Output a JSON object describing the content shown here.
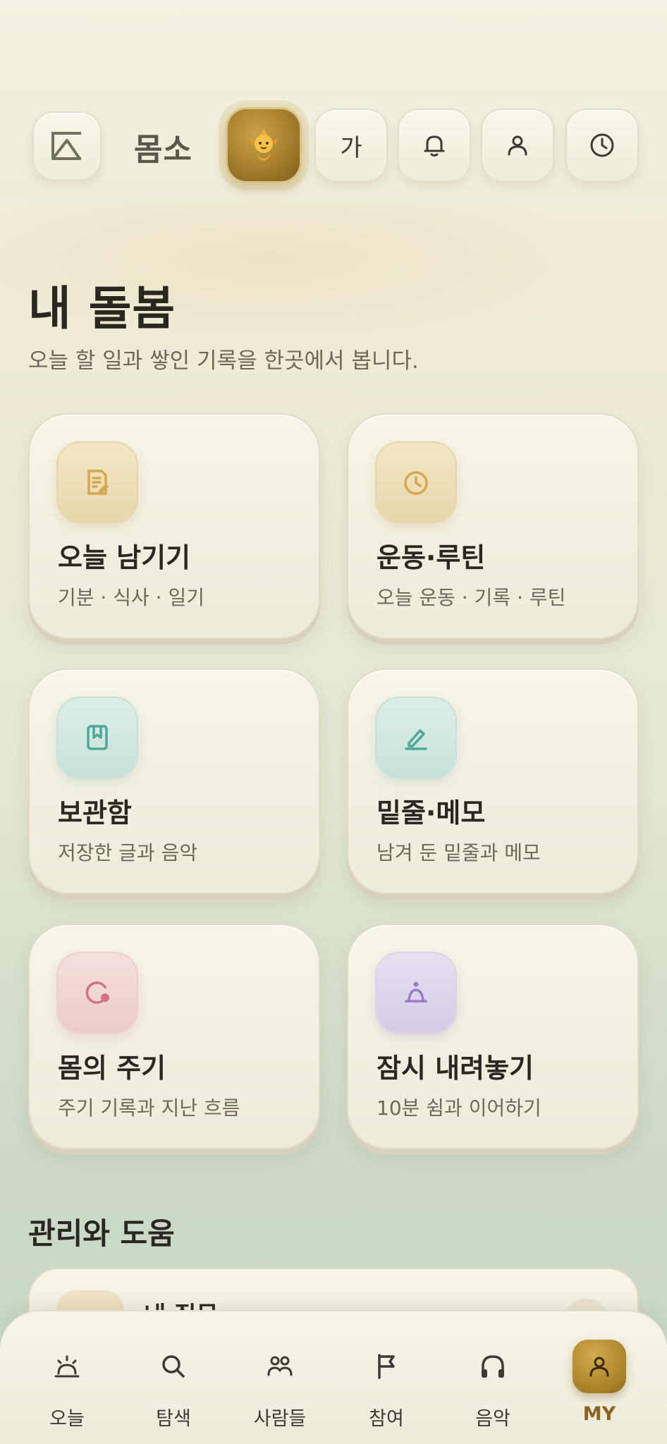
{
  "header": {
    "brand": "몸소",
    "text_size_label": "가",
    "icons": [
      "mountain-logo-icon",
      "mascot-icon",
      "bell-icon",
      "person-icon",
      "clock-icon"
    ]
  },
  "main": {
    "title": "내 돌봄",
    "subtitle": "오늘 할 일과 쌓인 기록을 한곳에서 봅니다.",
    "cards": [
      {
        "title": "오늘 남기기",
        "subtitle": "기분 · 식사 · 일기",
        "icon": "note-icon",
        "color": "#d4a84f"
      },
      {
        "title": "운동·루틴",
        "subtitle": "오늘 운동 · 기록 · 루틴",
        "icon": "timer-icon",
        "color": "#d4a84f"
      },
      {
        "title": "보관함",
        "subtitle": "저장한 글과 음악",
        "icon": "bookmark-icon",
        "color": "#4fa89a"
      },
      {
        "title": "밑줄·메모",
        "subtitle": "남겨 둔 밑줄과 메모",
        "icon": "pencil-icon",
        "color": "#4fa89a"
      },
      {
        "title": "몸의 주기",
        "subtitle": "주기 기록과 지난 흐름",
        "icon": "cycle-icon",
        "color": "#d27286"
      },
      {
        "title": "잠시 내려놓기",
        "subtitle": "10분 쉼과 이어하기",
        "icon": "rest-icon",
        "color": "#9a7cc6"
      }
    ],
    "section_title": "관리와 도움",
    "peek_item": {
      "title": "내 질문"
    }
  },
  "tabbar": {
    "tabs": [
      {
        "label": "오늘",
        "icon": "sunrise-icon"
      },
      {
        "label": "탐색",
        "icon": "search-icon"
      },
      {
        "label": "사람들",
        "icon": "people-icon"
      },
      {
        "label": "참여",
        "icon": "flag-icon"
      },
      {
        "label": "음악",
        "icon": "headphones-icon"
      },
      {
        "label": "MY",
        "icon": "person-icon",
        "active": true
      }
    ]
  },
  "colors": {
    "accent_gold": "#a98228",
    "text_dark": "#2a2620",
    "text_muted": "#6e685c"
  }
}
